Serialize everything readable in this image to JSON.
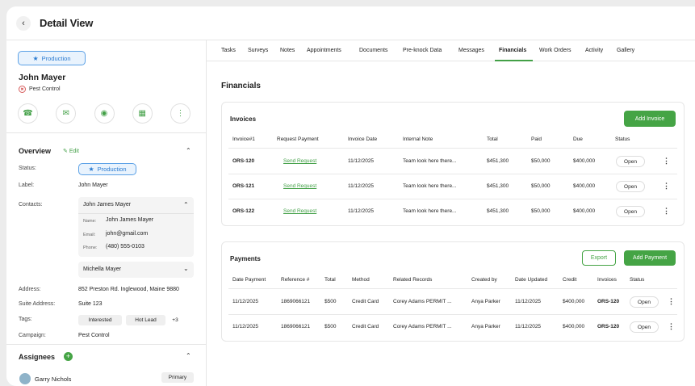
{
  "header": {
    "title": "Detail View"
  },
  "profile": {
    "status": "Production",
    "name": "John Mayer",
    "company": "Pest Control"
  },
  "overview": {
    "title": "Overview",
    "edit_label": "Edit",
    "status_label": "Status:",
    "status_value": "Production",
    "label_label": "Label:",
    "label_value": "John Mayer",
    "contacts_label": "Contacts:",
    "contact1": {
      "name": "John James Mayer",
      "name_label": "Name:",
      "name_value": "John James Mayer",
      "email_label": "Email:",
      "email_value": "john@gmail.com",
      "phone_label": "Phone:",
      "phone_value": "(480) 555-0103"
    },
    "contact2": {
      "name": "Michella Mayer"
    },
    "address_label": "Address:",
    "address_value": "852 Preston Rd. Inglewood, Maine 9880",
    "suite_label": "Suite Address:",
    "suite_value": "Suite 123",
    "tags_label": "Tags:",
    "tags": [
      "Interested",
      "Hot Lead",
      "+3"
    ],
    "campaign_label": "Campaign:",
    "campaign_value": "Pest Control"
  },
  "assignees": {
    "title": "Assignees",
    "first_name": "Garry Nichols",
    "first_role": "Primary"
  },
  "tabs": [
    "Tasks",
    "Surveys",
    "Notes",
    "Appointments",
    "Documents",
    "Pre-knock Data",
    "Messages",
    "Financials",
    "Work Orders",
    "Activity",
    "Gallery"
  ],
  "financials": {
    "title": "Financials",
    "invoices": {
      "title": "Invoices",
      "add_button": "Add Invoice",
      "columns": [
        "Invoice#1",
        "Request Payment",
        "Invoice Date",
        "Internal Note",
        "Total",
        "Paid",
        "Due",
        "Status"
      ],
      "rows": [
        {
          "id": "ORS-120",
          "request": "Send Request",
          "date": "11/12/2025",
          "note": "Team look here there...",
          "total": "$451,300",
          "paid": "$50,000",
          "due": "$400,000",
          "status": "Open"
        },
        {
          "id": "ORS-121",
          "request": "Send Request",
          "date": "11/12/2025",
          "note": "Team look here there...",
          "total": "$451,300",
          "paid": "$50,000",
          "due": "$400,000",
          "status": "Open"
        },
        {
          "id": "ORS-122",
          "request": "Send Request",
          "date": "11/12/2025",
          "note": "Team look here there...",
          "total": "$451,300",
          "paid": "$50,000",
          "due": "$400,000",
          "status": "Open"
        }
      ]
    },
    "payments": {
      "title": "Payments",
      "export_button": "Export",
      "add_button": "Add Payment",
      "columns": [
        "Date Payment",
        "Reference #",
        "Total",
        "Method",
        "Related Records",
        "Created by",
        "Date Updated",
        "Credit",
        "Invoices",
        "Status"
      ],
      "rows": [
        {
          "date": "11/12/2025",
          "ref": "1869066121",
          "total": "$500",
          "method": "Credit Card",
          "related": "Corey Adams PERMIT ...",
          "created_by": "Anya Parker",
          "updated": "11/12/2025",
          "credit": "$400,000",
          "invoice": "ORS-120",
          "status": "Open"
        },
        {
          "date": "11/12/2025",
          "ref": "1869066121",
          "total": "$500",
          "method": "Credit Card",
          "related": "Corey Adams PERMIT ...",
          "created_by": "Anya Parker",
          "updated": "11/12/2025",
          "credit": "$400,000",
          "invoice": "ORS-120",
          "status": "Open"
        }
      ]
    }
  }
}
